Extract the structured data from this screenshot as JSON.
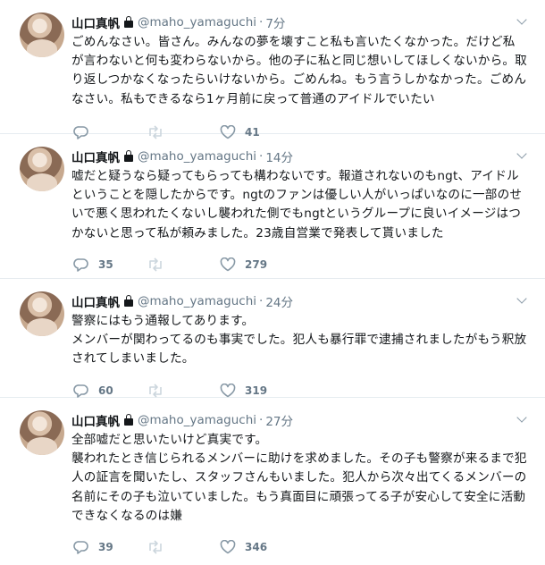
{
  "colors": {
    "text": "#14171a",
    "muted": "#657786",
    "icon": "#8899a6",
    "divider": "#e6ecf0"
  },
  "tweets": [
    {
      "name": "山口真帆",
      "handle": "@maho_yamaguchi",
      "sep": "·",
      "time": "7分",
      "text": "ごめんなさい。皆さん。みんなの夢を壊すこと私も言いたくなかった。だけど私が言わないと何も変わらないから。他の子に私と同じ想いしてほしくないから。取り返しつかなくなったらいけないから。ごめんね。もう言うしかなかった。ごめんなさい。私もできるなら1ヶ月前に戻って普通のアイドルでいたい",
      "replies": "",
      "retweets": "",
      "likes": "41"
    },
    {
      "name": "山口真帆",
      "handle": "@maho_yamaguchi",
      "sep": "·",
      "time": "14分",
      "text": "嘘だと疑うなら疑ってもらっても構わないです。報道されないのもngt、アイドルということを隠したからです。ngtのファンは優しい人がいっぱいなのに一部のせいで悪く思われたくないし襲われた側でもngtというグループに良いイメージはつかないと思って私が頼みました。23歳自営業で発表して貰いました",
      "replies": "35",
      "retweets": "",
      "likes": "279"
    },
    {
      "name": "山口真帆",
      "handle": "@maho_yamaguchi",
      "sep": "·",
      "time": "24分",
      "text": "警察にはもう通報してあります。\nメンバーが関わってるのも事実でした。犯人も暴行罪で逮捕されましたがもう釈放されてしまいました。",
      "replies": "60",
      "retweets": "",
      "likes": "319"
    },
    {
      "name": "山口真帆",
      "handle": "@maho_yamaguchi",
      "sep": "·",
      "time": "27分",
      "text": "全部嘘だと思いたいけど真実です。\n襲われたとき信じられるメンバーに助けを求めました。その子も警察が来るまで犯人の証言を聞いたし、スタッフさんもいました。犯人から次々出てくるメンバーの名前にその子も泣いていました。もう真面目に頑張ってる子が安心して安全に活動できなくなるのは嫌",
      "replies": "39",
      "retweets": "",
      "likes": "346"
    }
  ],
  "icons": {
    "reply": "reply-icon",
    "retweet": "retweet-icon",
    "like": "heart-icon",
    "protected": "lock-icon",
    "menu": "chevron-down-icon"
  }
}
